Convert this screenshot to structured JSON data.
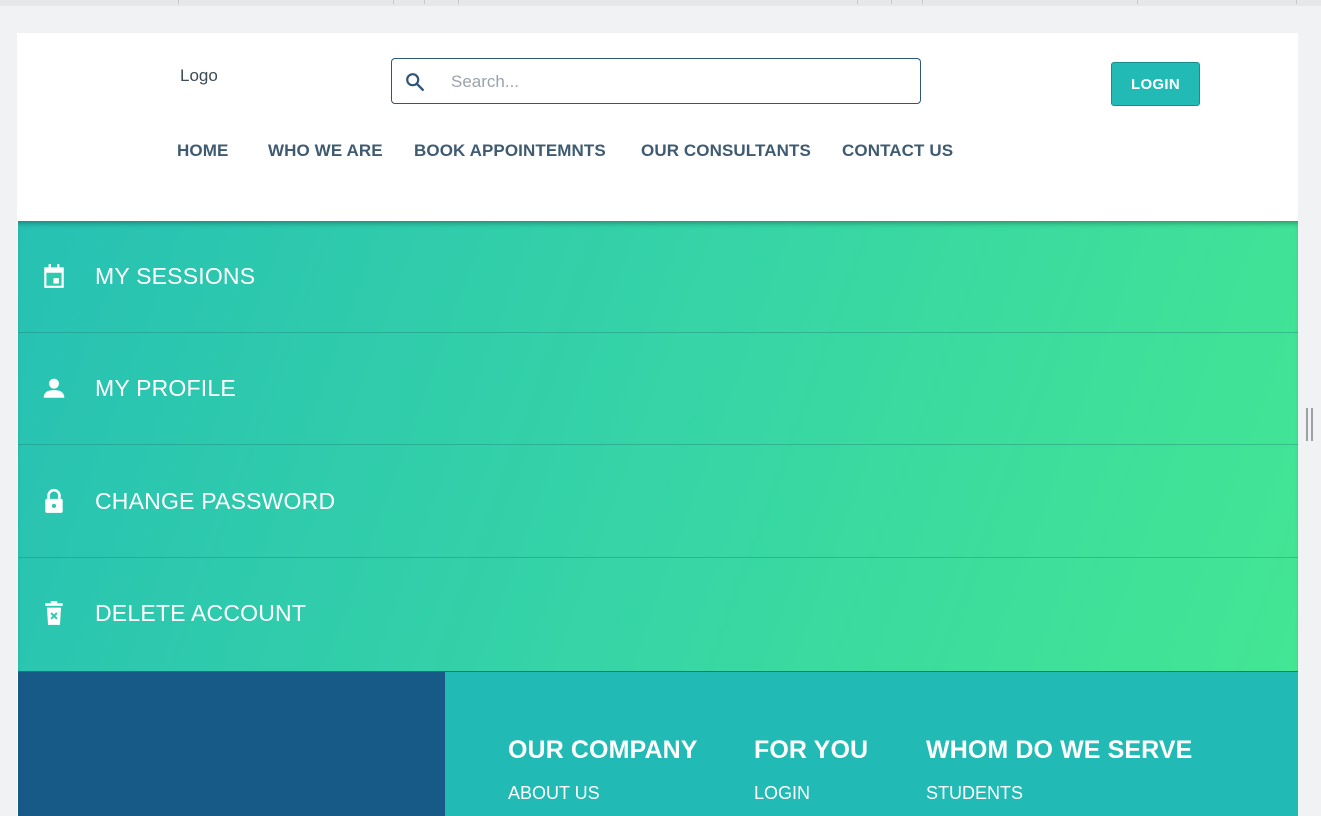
{
  "header": {
    "logo": "Logo",
    "search": {
      "placeholder": "Search..."
    },
    "login_label": "LOGIN",
    "nav": [
      {
        "label": "HOME"
      },
      {
        "label": "WHO WE ARE"
      },
      {
        "label": "BOOK APPOINTEMNTS"
      },
      {
        "label": "OUR CONSULTANTS"
      },
      {
        "label": "CONTACT US"
      }
    ]
  },
  "account_menu": [
    {
      "label": "MY SESSIONS",
      "icon": "calendar-icon"
    },
    {
      "label": "MY PROFILE",
      "icon": "person-icon"
    },
    {
      "label": "CHANGE PASSWORD",
      "icon": "lock-icon"
    },
    {
      "label": "DELETE ACCOUNT",
      "icon": "delete-icon"
    }
  ],
  "footer": {
    "columns": [
      {
        "title": "OUR COMPANY",
        "links": [
          "ABOUT US"
        ]
      },
      {
        "title": "FOR YOU",
        "links": [
          "LOGIN"
        ]
      },
      {
        "title": "WHOM DO WE SERVE",
        "links": [
          "STUDENTS"
        ]
      }
    ]
  },
  "colors": {
    "accent": "#22bab4",
    "nav_text": "#3f5b72",
    "footer_dark": "#175a87",
    "gradient_start": "#27c1b3",
    "gradient_end": "#43e693"
  }
}
